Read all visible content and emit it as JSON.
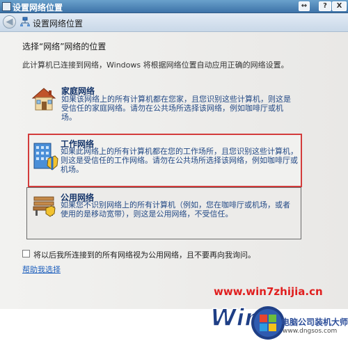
{
  "window": {
    "title": "设置网络位置",
    "button_resize": "↔",
    "button_help": "?",
    "button_close": "X"
  },
  "nav": {
    "back_glyph": "◀",
    "title": "设置网络位置"
  },
  "main": {
    "heading": "选择“网络”网络的位置",
    "description": "此计算机已连接到网络，Windows 将根据网络位置自动应用正确的网络设置。"
  },
  "options": [
    {
      "title": "家庭网络",
      "text": "如果该网络上的所有计算机都在您家，且您识别这些计算机，则这是受信任的家庭网络。请勿在公共场所选择该网络，例如咖啡厅或机场。",
      "icon": "house-icon"
    },
    {
      "title": "工作网络",
      "text": "如果此网络上的所有计算机都在您的工作场所，且您识别这些计算机，则这是受信任的工作网络。请勿在公共场所选择该网络，例如咖啡厅或机场。",
      "icon": "office-building-icon"
    },
    {
      "title": "公用网络",
      "text": "如果您不识别网络上的所有计算机（例如，您在咖啡厅或机场，或者使用的是移动宽带），则这是公用网络，不受信任。",
      "icon": "park-bench-icon"
    }
  ],
  "checkbox": {
    "label": "将以后我所连接到的所有网络视为公用网络，且不要再向我询问。",
    "checked": false
  },
  "help_link": "帮助我选择",
  "watermark": {
    "url": "www.win7zhijia.cn",
    "logo_text": "Win7",
    "site_cn": "电脑公司装机大师",
    "site_url": "www.dngsos.com"
  },
  "colors": {
    "selection_border": "#d33b3b",
    "option_title": "#14346a",
    "option_text": "#244a86",
    "link": "#1d5fbd",
    "watermark_red": "#e01f1f"
  }
}
